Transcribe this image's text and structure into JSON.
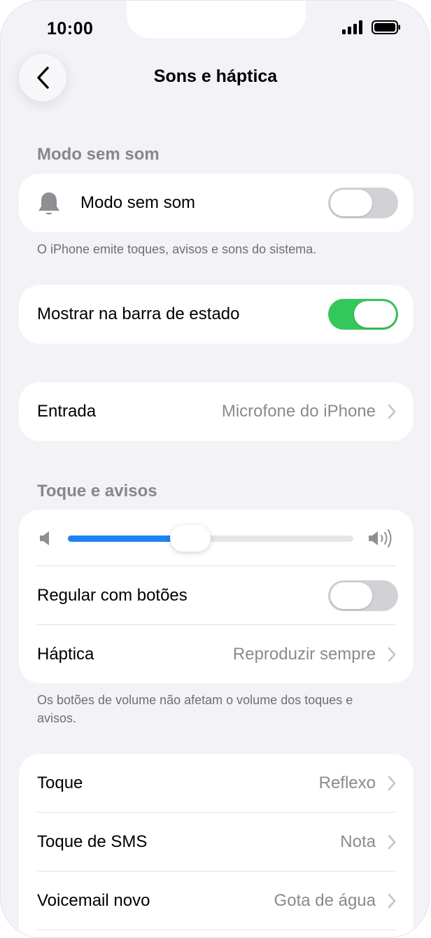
{
  "status_bar": {
    "time": "10:00"
  },
  "nav": {
    "title": "Sons e háptica"
  },
  "silent_section": {
    "header": "Modo sem som",
    "row_label": "Modo sem som",
    "toggle_on": false,
    "footnote": "O iPhone emite toques, avisos e sons do sistema."
  },
  "status_bar_row": {
    "label": "Mostrar na barra de estado",
    "toggle_on": true
  },
  "input_row": {
    "label": "Entrada",
    "value": "Microfone do iPhone"
  },
  "ringer_section": {
    "header": "Toque e avisos",
    "volume_fraction": 0.43,
    "adjust_label": "Regular com botões",
    "adjust_toggle_on": false,
    "haptics_label": "Háptica",
    "haptics_value": "Reproduzir sempre",
    "footnote": "Os botões de volume não afetam o volume dos toques e avisos."
  },
  "sounds_list": [
    {
      "label": "Toque",
      "value": "Reflexo"
    },
    {
      "label": "Toque de SMS",
      "value": "Nota"
    },
    {
      "label": "Voicemail novo",
      "value": "Gota de água"
    }
  ],
  "colors": {
    "accent_blue": "#1a84f2",
    "toggle_green": "#34c759",
    "background": "#f2f2f7"
  }
}
